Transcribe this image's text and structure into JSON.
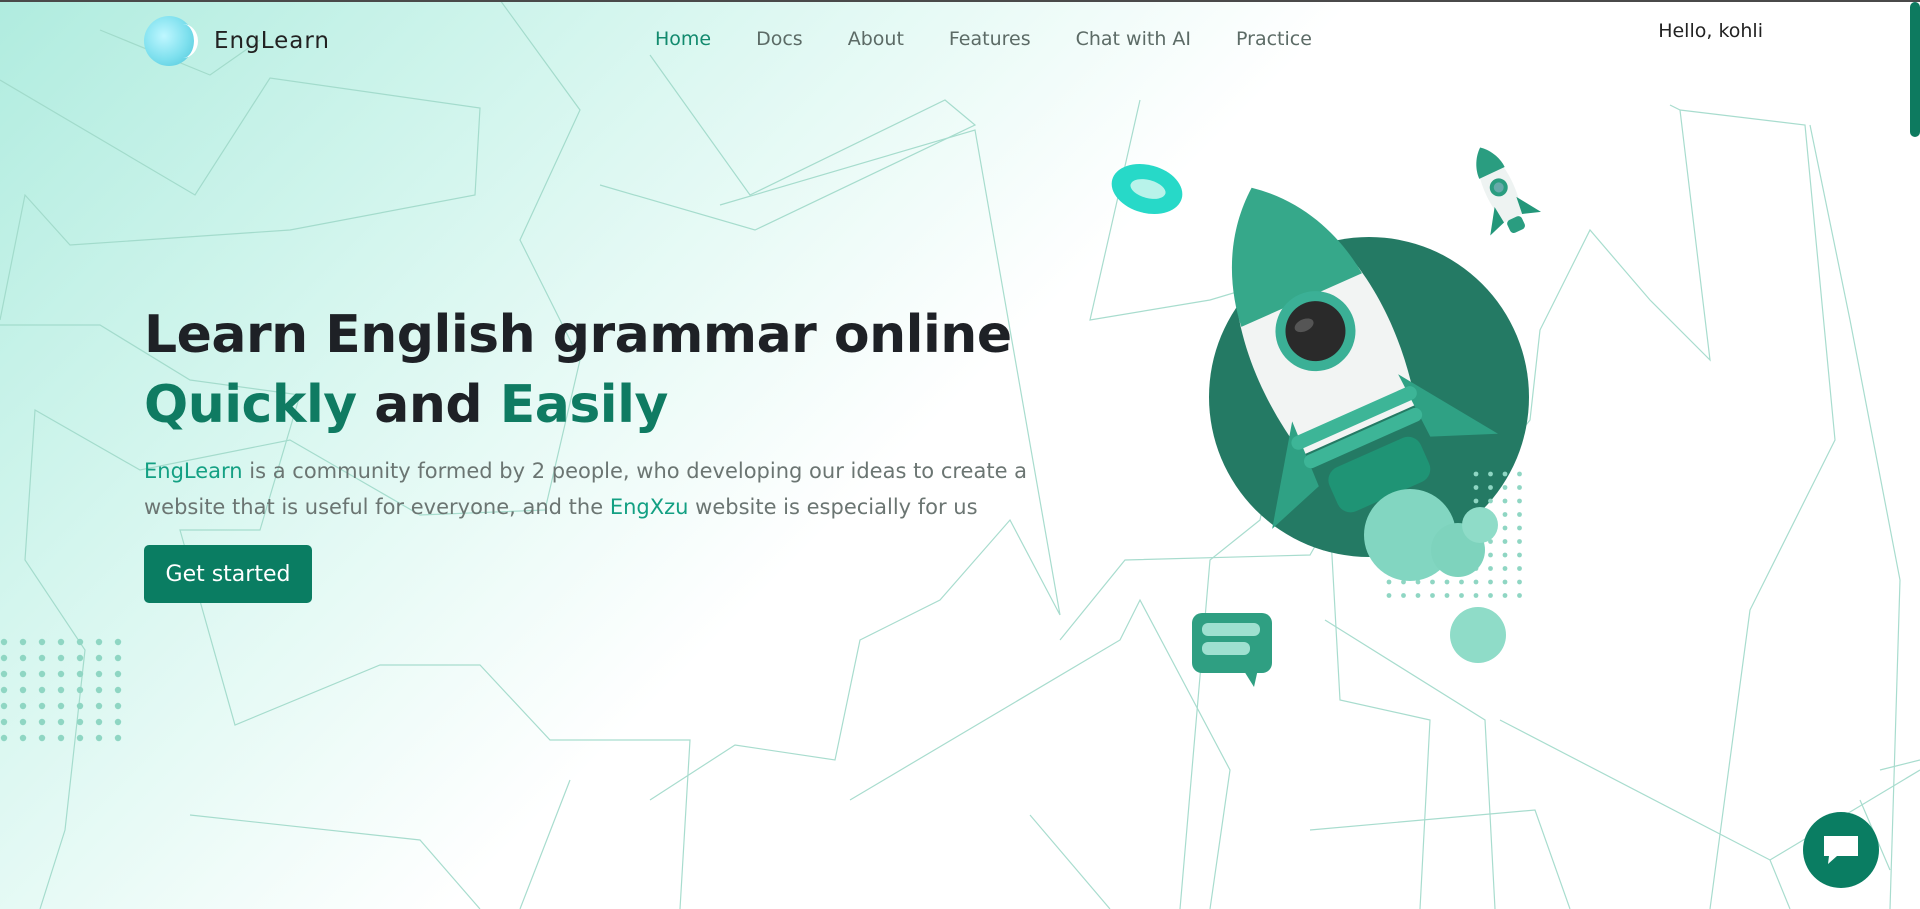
{
  "brand": {
    "name": "EngLearn",
    "logo_icon": "moon-logo-icon"
  },
  "nav": {
    "items": [
      {
        "label": "Home",
        "active": true
      },
      {
        "label": "Docs",
        "active": false
      },
      {
        "label": "About",
        "active": false
      },
      {
        "label": "Features",
        "active": false
      },
      {
        "label": "Chat with AI",
        "active": false
      },
      {
        "label": "Practice",
        "active": false
      }
    ]
  },
  "user": {
    "greeting": "Hello, kohli"
  },
  "hero": {
    "title_line1": "Learn English grammar online",
    "title_word1": "Quickly",
    "title_connector": " and ",
    "title_word2": "Easily",
    "desc_brand": "EngLearn",
    "desc_part1": " is a community formed by 2 people, who developing our ideas to create a website that is useful for everyone, and the ",
    "desc_brand2": "EngXzu",
    "desc_part2": " website is especially for us",
    "cta_label": "Get started"
  },
  "illustration": {
    "icon": "rocket-icon"
  },
  "chat_widget": {
    "icon": "chat-bubble-icon"
  },
  "colors": {
    "accent": "#0f7b62",
    "button": "#0a7d62",
    "highlight": "#13a083",
    "nav_active": "#128a6e",
    "background_tint": "#b0ecdf"
  }
}
